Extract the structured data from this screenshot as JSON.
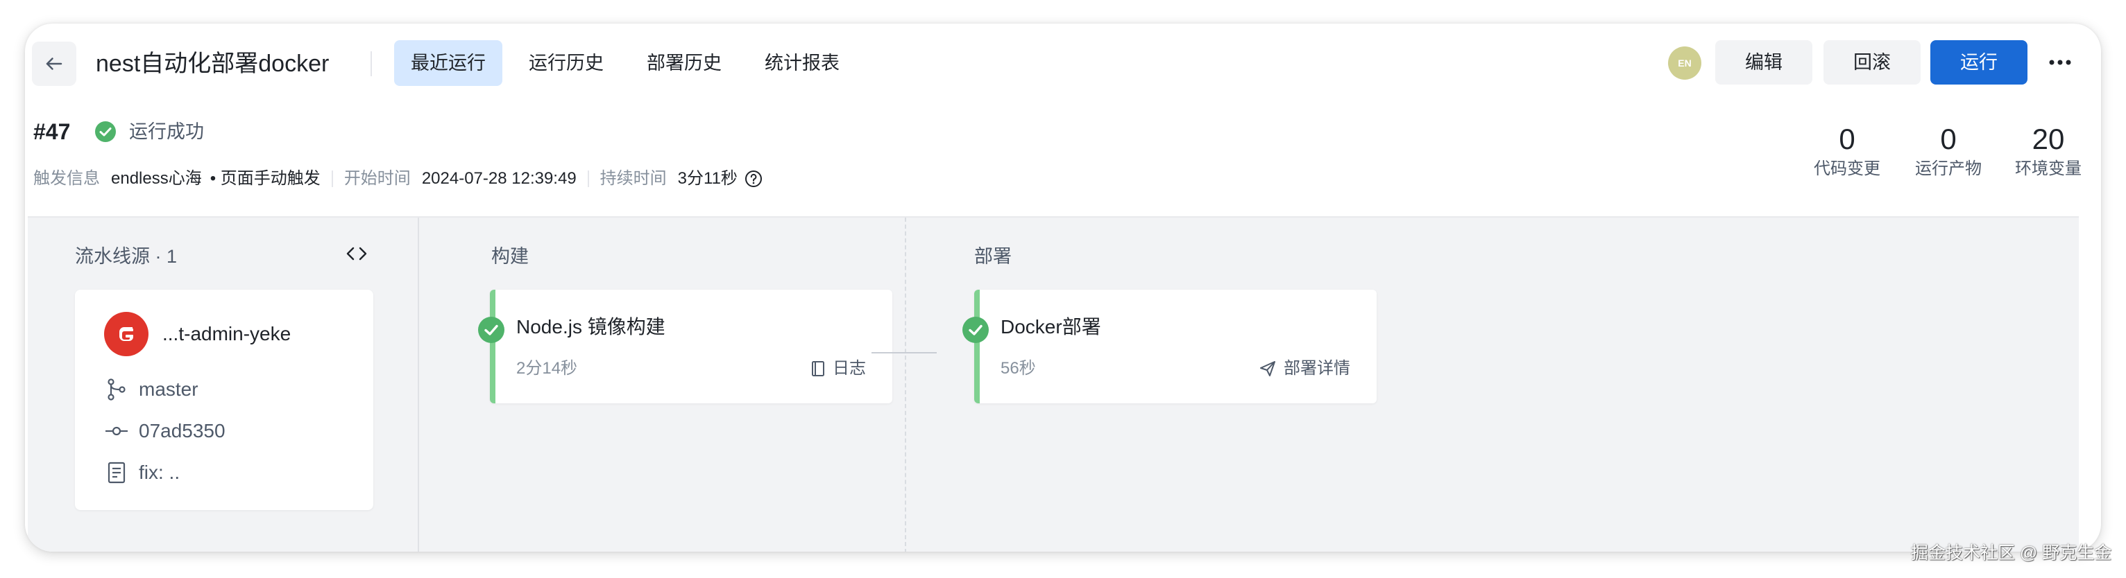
{
  "header": {
    "back_icon": "arrow-left-icon",
    "title": "nest自动化部署docker",
    "tabs": [
      {
        "label": "最近运行",
        "active": true
      },
      {
        "label": "运行历史",
        "active": false
      },
      {
        "label": "部署历史",
        "active": false
      },
      {
        "label": "统计报表",
        "active": false
      }
    ],
    "user_badge": "EN",
    "edit_label": "编辑",
    "rollback_label": "回滚",
    "run_label": "运行",
    "more_icon": "more-horizontal-icon"
  },
  "run": {
    "number": "#47",
    "status": "运行成功",
    "trigger_label": "触发信息",
    "trigger_user": "endless心海",
    "trigger_type": "• 页面手动触发",
    "start_label": "开始时间",
    "start_time": "2024-07-28 12:39:49",
    "duration_label": "持续时间",
    "duration": "3分11秒"
  },
  "stats": [
    {
      "value": "0",
      "label": "代码变更"
    },
    {
      "value": "0",
      "label": "运行产物"
    },
    {
      "value": "20",
      "label": "环境变量"
    }
  ],
  "pipeline": {
    "source": {
      "title": "流水线源 · 1",
      "repo": "...t-admin-yeke",
      "branch": "master",
      "commit": "07ad5350",
      "message": "fix: .."
    },
    "build": {
      "title": "构建",
      "job": "Node.js 镜像构建",
      "duration": "2分14秒",
      "action": "日志"
    },
    "deploy": {
      "title": "部署",
      "job": "Docker部署",
      "duration": "56秒",
      "action": "部署详情"
    }
  },
  "colors": {
    "accent": "#1a6ad6",
    "active_tab_bg": "#d6e8ff",
    "success": "#4fb36a",
    "stage_bar": "#7fd190",
    "repo_logo": "#e0352b"
  },
  "watermark": "掘金技术社区 @ 野克生金"
}
